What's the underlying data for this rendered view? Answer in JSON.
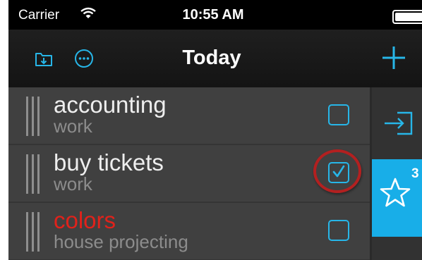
{
  "status_bar": {
    "carrier": "Carrier",
    "time": "10:55 AM",
    "wifi_icon": "wifi-icon",
    "battery_icon": "battery-icon"
  },
  "nav_bar": {
    "title": "Today",
    "left_icons": [
      "import-folder-icon",
      "more-options-icon"
    ],
    "right_icon": "add-icon"
  },
  "tasks": [
    {
      "title": "accounting",
      "subtitle": "work",
      "checked": false,
      "title_color": "#eeeeee"
    },
    {
      "title": "buy tickets",
      "subtitle": "work",
      "checked": true,
      "title_color": "#eeeeee"
    },
    {
      "title": "colors",
      "subtitle": "house projecting",
      "checked": false,
      "title_color": "#e0221b"
    }
  ],
  "side_panel": {
    "items": [
      {
        "icon": "inbox-import-icon"
      },
      {
        "icon": "star-icon",
        "badge": "3",
        "active": true
      }
    ]
  },
  "colors": {
    "accent": "#27b6e8",
    "active_tab": "#18aee8",
    "highlight_ring": "#b32020",
    "background": "#3e3e3e"
  }
}
